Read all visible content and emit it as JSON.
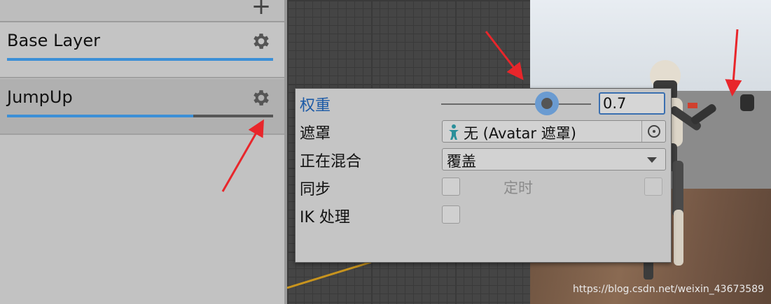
{
  "layers_panel": {
    "add_icon": "plus-icon",
    "layers": [
      {
        "name": "Base Layer",
        "weight": 1.0
      },
      {
        "name": "JumpUp",
        "weight": 0.7
      }
    ],
    "settings_icon": "gear-icon"
  },
  "layer_settings": {
    "weight": {
      "label": "权重",
      "value": "0.7",
      "slider_value": 0.7
    },
    "mask": {
      "label": "遮罩",
      "value": "无 (Avatar 遮罩)"
    },
    "blending": {
      "label": "正在混合",
      "value": "覆盖"
    },
    "sync": {
      "label": "同步",
      "checked": false
    },
    "timing": {
      "label": "定时",
      "checked": false
    },
    "ik_pass": {
      "label": "IK 处理",
      "checked": false
    }
  },
  "watermark": "https://blog.csdn.net/weixin_43673589",
  "colors": {
    "accent": "#3c8fd6",
    "active_label": "#1c5aa6",
    "arrow": "#e8262b"
  }
}
